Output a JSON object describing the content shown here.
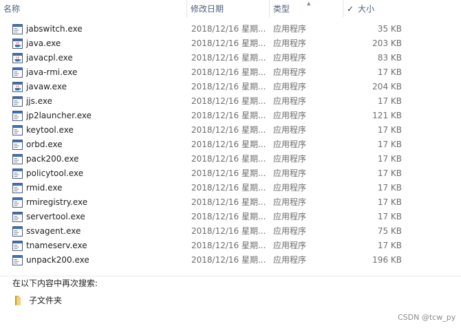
{
  "columns": {
    "name": "名称",
    "date": "修改日期",
    "type": "类型",
    "size": "大小",
    "size_check": "✓"
  },
  "files": [
    {
      "name": "jabswitch.exe",
      "date": "2018/12/16 星期...",
      "type": "应用程序",
      "size": "35 KB",
      "icon": "exe-window-icon"
    },
    {
      "name": "java.exe",
      "date": "2018/12/16 星期...",
      "type": "应用程序",
      "size": "203 KB",
      "icon": "java-cup-icon"
    },
    {
      "name": "javacpl.exe",
      "date": "2018/12/16 星期...",
      "type": "应用程序",
      "size": "83 KB",
      "icon": "java-cup-icon"
    },
    {
      "name": "java-rmi.exe",
      "date": "2018/12/16 星期...",
      "type": "应用程序",
      "size": "17 KB",
      "icon": "exe-window-icon"
    },
    {
      "name": "javaw.exe",
      "date": "2018/12/16 星期...",
      "type": "应用程序",
      "size": "204 KB",
      "icon": "java-cup-icon"
    },
    {
      "name": "jjs.exe",
      "date": "2018/12/16 星期...",
      "type": "应用程序",
      "size": "17 KB",
      "icon": "exe-window-icon"
    },
    {
      "name": "jp2launcher.exe",
      "date": "2018/12/16 星期...",
      "type": "应用程序",
      "size": "121 KB",
      "icon": "exe-window-icon"
    },
    {
      "name": "keytool.exe",
      "date": "2018/12/16 星期...",
      "type": "应用程序",
      "size": "17 KB",
      "icon": "exe-window-icon"
    },
    {
      "name": "orbd.exe",
      "date": "2018/12/16 星期...",
      "type": "应用程序",
      "size": "17 KB",
      "icon": "exe-window-icon"
    },
    {
      "name": "pack200.exe",
      "date": "2018/12/16 星期...",
      "type": "应用程序",
      "size": "17 KB",
      "icon": "exe-window-icon"
    },
    {
      "name": "policytool.exe",
      "date": "2018/12/16 星期...",
      "type": "应用程序",
      "size": "17 KB",
      "icon": "exe-window-icon"
    },
    {
      "name": "rmid.exe",
      "date": "2018/12/16 星期...",
      "type": "应用程序",
      "size": "17 KB",
      "icon": "exe-window-icon"
    },
    {
      "name": "rmiregistry.exe",
      "date": "2018/12/16 星期...",
      "type": "应用程序",
      "size": "17 KB",
      "icon": "exe-window-icon"
    },
    {
      "name": "servertool.exe",
      "date": "2018/12/16 星期...",
      "type": "应用程序",
      "size": "17 KB",
      "icon": "exe-window-icon"
    },
    {
      "name": "ssvagent.exe",
      "date": "2018/12/16 星期...",
      "type": "应用程序",
      "size": "75 KB",
      "icon": "exe-window-icon"
    },
    {
      "name": "tnameserv.exe",
      "date": "2018/12/16 星期...",
      "type": "应用程序",
      "size": "17 KB",
      "icon": "exe-window-icon"
    },
    {
      "name": "unpack200.exe",
      "date": "2018/12/16 星期...",
      "type": "应用程序",
      "size": "196 KB",
      "icon": "exe-window-icon"
    }
  ],
  "search_again": {
    "label": "在以下内容中再次搜索:",
    "subfolder": "子文件夹",
    "subfolder_icon": "folder-icon"
  },
  "watermark": "CSDN @tcw_py"
}
